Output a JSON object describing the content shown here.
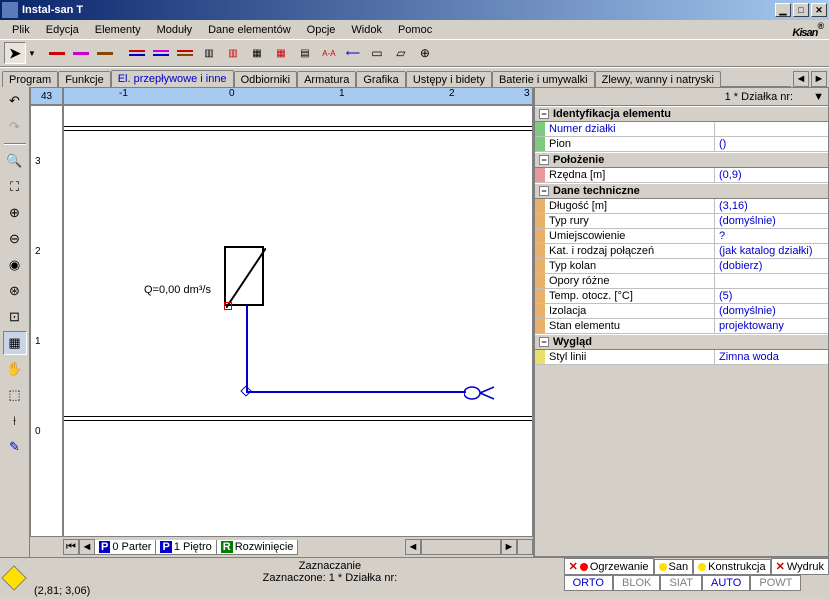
{
  "title": "Instal-san T",
  "menubar": [
    "Plik",
    "Edycja",
    "Elementy",
    "Moduły",
    "Dane elementów",
    "Opcje",
    "Widok",
    "Pomoc"
  ],
  "logo": "Kisan",
  "tabs": [
    "Program",
    "Funkcje",
    "El. przepływowe i inne",
    "Odbiorniki",
    "Armatura",
    "Grafika",
    "Ustępy i bidety",
    "Baterie i umywalki",
    "Zlewy, wanny i natryski"
  ],
  "active_tab": 2,
  "ruler_corner": "43",
  "ruler_h": [
    "-1",
    "0",
    "1",
    "2",
    "3"
  ],
  "ruler_v": [
    "3",
    "2",
    "1",
    "0"
  ],
  "canvas_label": "Q=0,00 dm³/s",
  "sheet_tabs": [
    {
      "badge": "P",
      "label": "0 Parter",
      "color": "blue"
    },
    {
      "badge": "P",
      "label": "1 Piętro",
      "color": "blue"
    },
    {
      "badge": "R",
      "label": "Rozwinięcie",
      "color": "green"
    }
  ],
  "prop_header": "1 * Działka nr:",
  "sections": [
    {
      "title": "Identyfikacja elementu",
      "stripe": "green",
      "rows": [
        {
          "label": "Numer działki",
          "value": "",
          "label_blue": true
        },
        {
          "label": "Pion",
          "value": "()"
        }
      ]
    },
    {
      "title": "Położenie",
      "stripe": "pink",
      "rows": [
        {
          "label": "Rzędna [m]",
          "value": "(0,9)"
        }
      ]
    },
    {
      "title": "Dane techniczne",
      "stripe": "orange",
      "rows": [
        {
          "label": "Długość [m]",
          "value": "(3,16)"
        },
        {
          "label": "Typ rury",
          "value": "(domyślnie)"
        },
        {
          "label": "Umiejscowienie",
          "value": "?"
        },
        {
          "label": "Kat. i rodzaj połączeń",
          "value": "(jak katalog działki)"
        },
        {
          "label": "Typ kolan",
          "value": "(dobierz)"
        },
        {
          "label": "Opory różne",
          "value": ""
        },
        {
          "label": "Temp. otocz. [°C]",
          "value": "(5)"
        },
        {
          "label": "Izolacja",
          "value": "(domyślnie)"
        },
        {
          "label": "Stan elementu",
          "value": "projektowany"
        }
      ]
    },
    {
      "title": "Wygląd",
      "stripe": "yellow",
      "rows": [
        {
          "label": "Styl linii",
          "value": "Zimna woda"
        }
      ]
    }
  ],
  "coords": "(2,81; 3,06)",
  "status_mid_line1": "Zaznaczanie",
  "status_mid_line2": "Zaznaczone: 1 * Działka nr:",
  "status_tabs": [
    {
      "label": "Ogrzewanie",
      "color": "#ff0000",
      "x": true
    },
    {
      "label": "San",
      "color": "#ffe000"
    },
    {
      "label": "Konstrukcja",
      "color": "#ffe000"
    },
    {
      "label": "Wydruk",
      "x": true
    }
  ],
  "modes": [
    {
      "label": "ORTO",
      "active": true
    },
    {
      "label": "BLOK",
      "active": false
    },
    {
      "label": "SIAT",
      "active": false
    },
    {
      "label": "AUTO",
      "active": true
    },
    {
      "label": "POWT",
      "active": false
    }
  ]
}
